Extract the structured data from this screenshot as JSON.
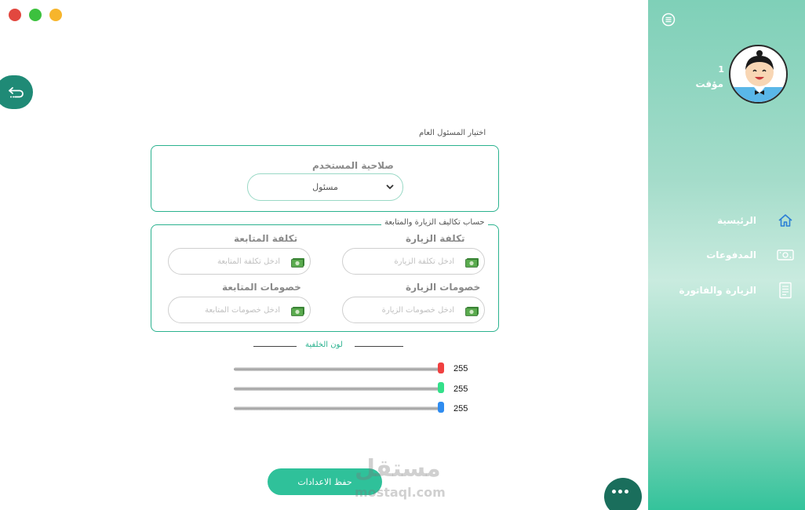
{
  "window": {
    "controls": [
      "close",
      "maximize",
      "minimize"
    ]
  },
  "sidebar": {
    "user_number": "1",
    "user_name": "مؤقت",
    "items": [
      {
        "label": "الرئيسية",
        "icon": "home-icon"
      },
      {
        "label": "المدفوعات",
        "icon": "payments-icon"
      },
      {
        "label": "الزيارة والفاتورة",
        "icon": "invoice-icon"
      }
    ],
    "colors": {
      "gradient_top": "#7fd0b8",
      "gradient_bottom": "#34c39b"
    }
  },
  "admin_section": {
    "title": "اختيار المسئول العام",
    "permission_label": "صلاحية المستخدم",
    "permission_value": "مسئول"
  },
  "costs_section": {
    "title": "حساب تكاليف الزيارة والمتابعة",
    "visit_cost_label": "تكلفة الزيارة",
    "visit_cost_placeholder": "ادخل تكلفة الزيارة",
    "followup_cost_label": "تكلفة المتابعة",
    "followup_cost_placeholder": "ادخل تكلفة المتابعة",
    "visit_discount_label": "خصومات الزيارة",
    "visit_discount_placeholder": "ادخل خصومات الزيارة",
    "followup_discount_label": "خصومات المتابعة",
    "followup_discount_placeholder": "ادخل خصومات المتابعة"
  },
  "background_color": {
    "title": "لون الخلفية",
    "red": 255,
    "green": 255,
    "blue": 255,
    "max": 255
  },
  "save_label": "حفظ الاعدادات",
  "watermark": {
    "arabic": "مستقل",
    "latin": "mostaql.com"
  },
  "accent": "#2bb28f"
}
